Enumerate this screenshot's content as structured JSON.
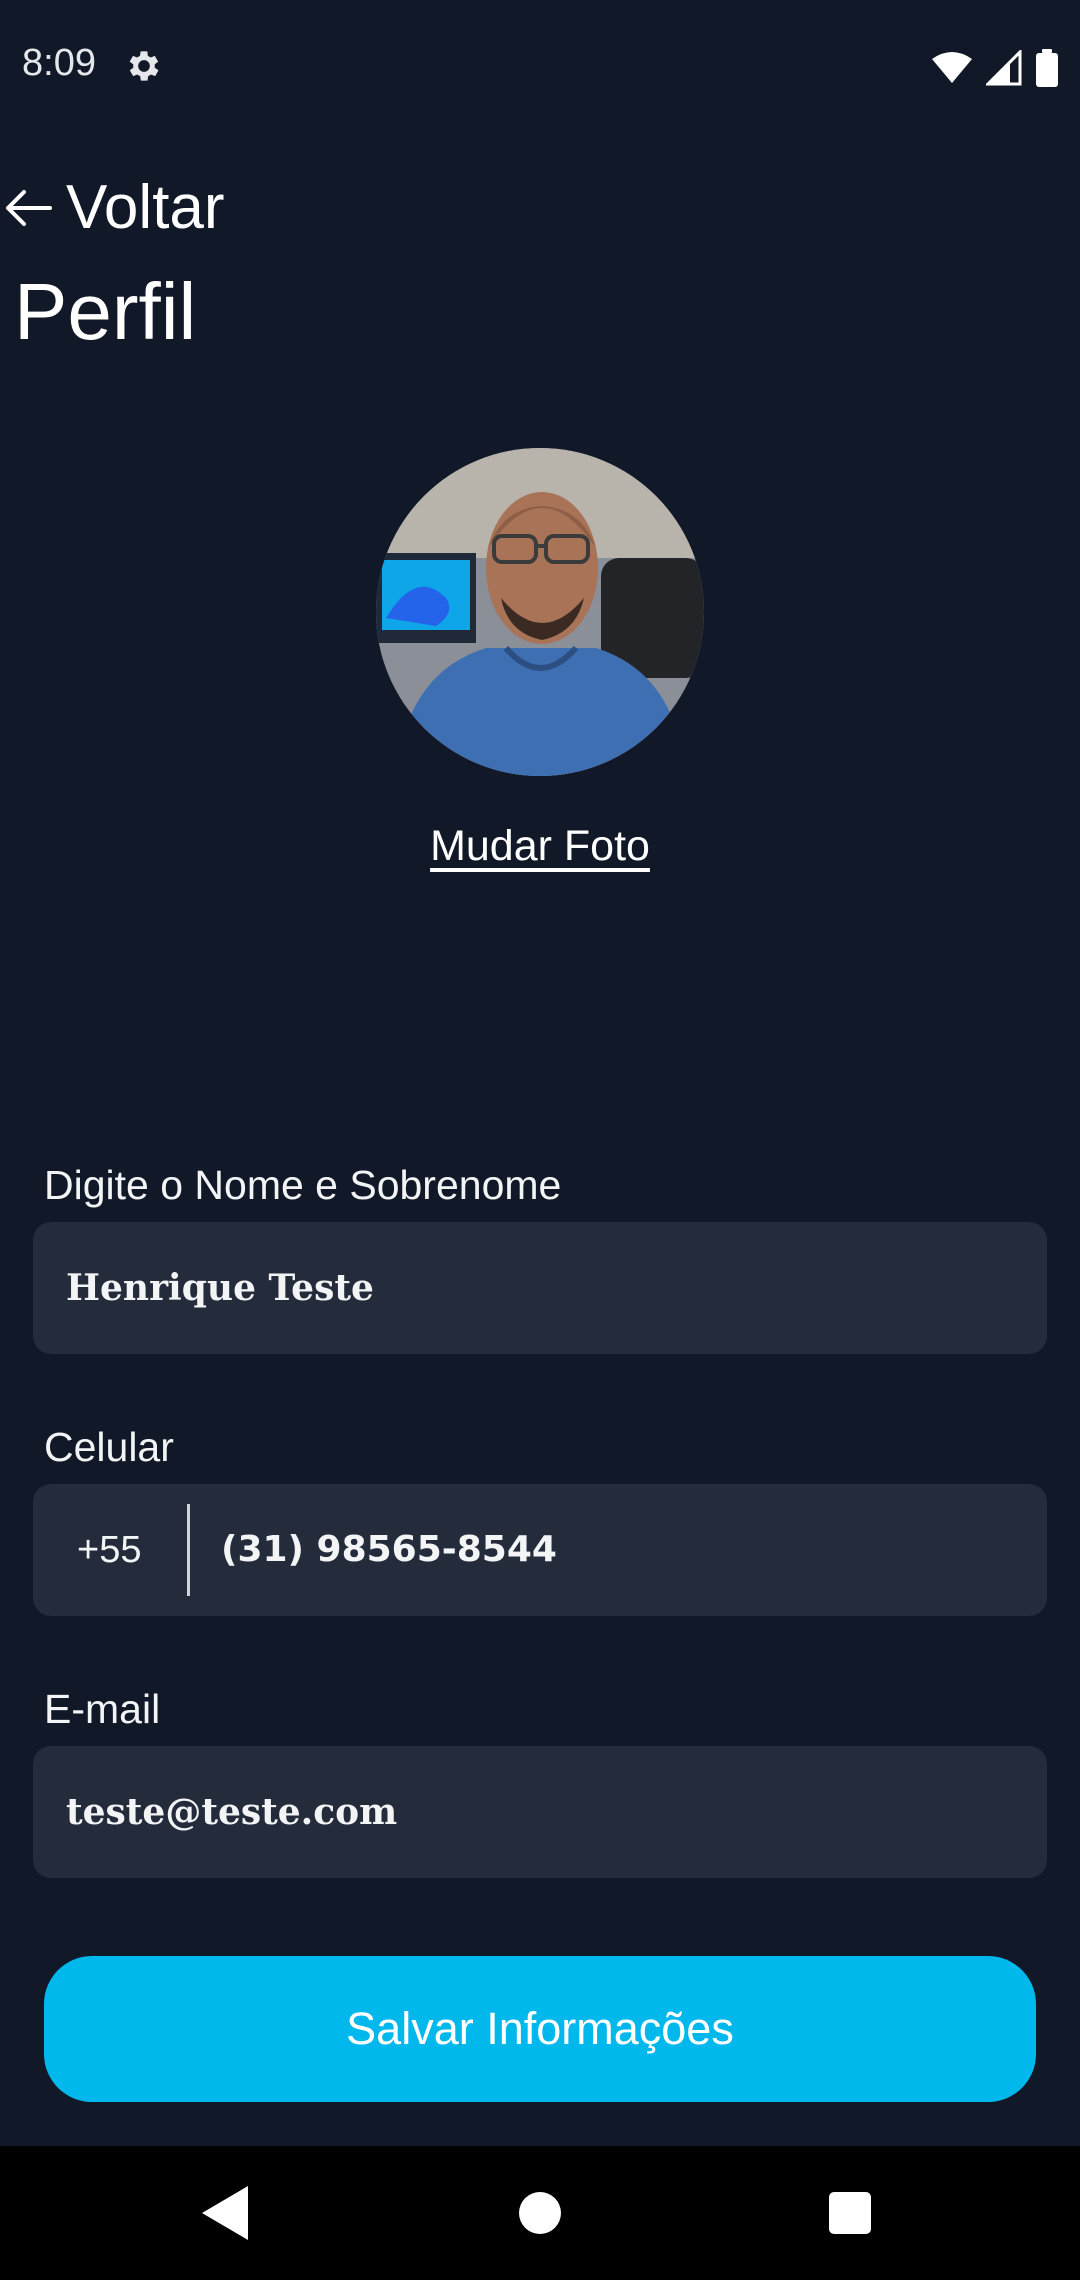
{
  "status_bar": {
    "time": "8:09",
    "icons": [
      "gear-icon",
      "wifi-icon",
      "cell-signal-icon",
      "battery-icon"
    ]
  },
  "header": {
    "back_label": "Voltar",
    "back_icon": "arrow-left-icon",
    "title": "Perfil"
  },
  "profile": {
    "change_photo_label": "Mudar Foto"
  },
  "form": {
    "name": {
      "label": "Digite o Nome e Sobrenome",
      "value": "Henrique Teste"
    },
    "phone": {
      "label": "Celular",
      "country_code": "+55",
      "value": "(31) 98565-8544"
    },
    "email": {
      "label": "E-mail",
      "value": "teste@teste.com"
    }
  },
  "actions": {
    "save_label": "Salvar Informações"
  },
  "nav_bar": {
    "icons": [
      "back-triangle-icon",
      "home-circle-icon",
      "recents-square-icon"
    ]
  },
  "colors": {
    "background": "#111827",
    "field_background": "#242b3b",
    "accent": "#00b8ec",
    "nav_bar": "#000000"
  }
}
